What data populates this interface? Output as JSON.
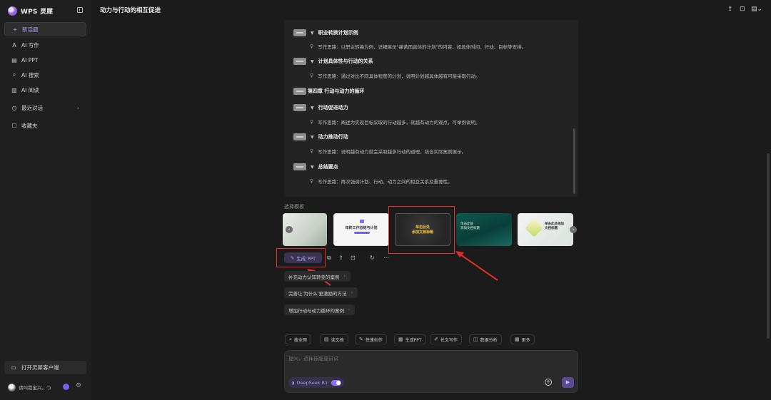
{
  "sidebar": {
    "brand": "WPS 灵犀",
    "items": [
      {
        "icon": "+",
        "label": "新话题"
      },
      {
        "icon": "A",
        "label": "AI 写作"
      },
      {
        "icon": "▤",
        "label": "AI PPT"
      },
      {
        "icon": "⌕",
        "label": "AI 搜索"
      },
      {
        "icon": "▥",
        "label": "AI 阅读"
      },
      {
        "icon": "◷",
        "label": "最近对话"
      },
      {
        "icon": "☐",
        "label": "收藏夹"
      }
    ],
    "client_button": "打开灵犀客户端",
    "user_name": "请叫我宝兴。つ"
  },
  "header": {
    "title": "动力与行动的相互促进"
  },
  "outline": [
    {
      "type": "h2",
      "text": "职业转换计划示例"
    },
    {
      "type": "note",
      "text": "写作思路：以职业转换为例，详细展示\"痛苦而具体的计划\"的内容，如具体时间、行动、目标等安排。"
    },
    {
      "type": "h2",
      "text": "计划具体性与行动的关系"
    },
    {
      "type": "note",
      "text": "写作思路：通过对比不同具体程度的计划，说明计划越具体越有可能采取行动。"
    },
    {
      "type": "h1",
      "text": "第四章 行动与动力的循环"
    },
    {
      "type": "h2",
      "text": "行动促进动力"
    },
    {
      "type": "note",
      "text": "写作思路：阐述为实现目标采取的行动越多，就越有动力的观点，可举例说明。"
    },
    {
      "type": "h2",
      "text": "动力推动行动"
    },
    {
      "type": "note",
      "text": "写作思路：说明越有动力就会采取越多行动的道理，结合实际案例展示。"
    },
    {
      "type": "h2",
      "text": "总结要点"
    },
    {
      "type": "note",
      "text": "写作思路：再次强调计划、行动、动力之间的相互关系及重要性。"
    }
  ],
  "templates": {
    "label": "选择模板",
    "b_title": "年终工作总结与计划",
    "c_title_1": "单击此处",
    "c_title_2": "添加文档标题",
    "d_title_1": "单击此处",
    "d_title_2": "添加文档标题",
    "e_title_1": "单击此处添加",
    "e_title_2": "文档标题"
  },
  "actions": {
    "generate_ppt": "生成 PPT"
  },
  "suggestions": [
    "补充动力认知转变的案例",
    "完善让'为什么'更激励的方法",
    "增加行动与动力循环的案例"
  ],
  "tools": [
    {
      "icon": "⌕",
      "label": "搜全网"
    },
    {
      "icon": "▤",
      "label": "读文档"
    },
    {
      "icon": "✎",
      "label": "快速创作"
    },
    {
      "icon": "▦",
      "label": "生成PPT"
    },
    {
      "icon": "✐",
      "label": "长文写作"
    },
    {
      "icon": "◫",
      "label": "数据分析"
    },
    {
      "icon": "▦",
      "label": "更多"
    }
  ],
  "input": {
    "placeholder": "提问，选择技能或试试"
  },
  "model": {
    "label": "DeepSeek R1"
  },
  "colors": {
    "accent": "#8d72f2",
    "annotation": "#e52b2b",
    "background": "#1b1b1b"
  }
}
